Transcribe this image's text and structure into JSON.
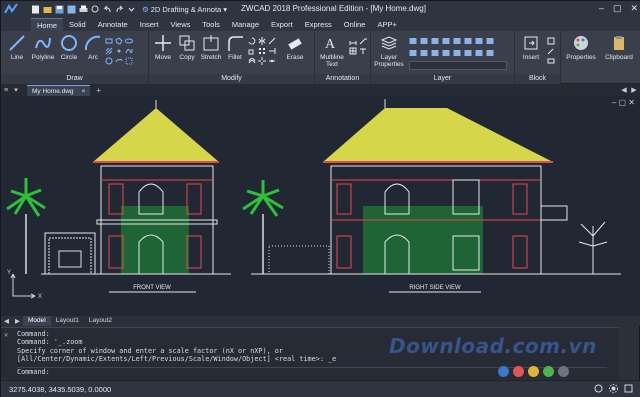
{
  "titlebar": {
    "workspace": "2D Drafting & Annota",
    "title": "ZWCAD 2018 Professional Edition - [My Home.dwg]",
    "controls": [
      "–",
      "▢",
      "✕"
    ]
  },
  "tabs": [
    "Home",
    "Solid",
    "Annotate",
    "Insert",
    "Views",
    "Tools",
    "Manage",
    "Export",
    "Express",
    "Online",
    "APP+"
  ],
  "ribbon": {
    "draw": {
      "title": "Draw",
      "tools": [
        "Line",
        "Polyline",
        "Circle",
        "Arc"
      ]
    },
    "modify": {
      "title": "Modify",
      "tools": [
        "Move",
        "Copy",
        "Stretch",
        "Fillet",
        "Erase"
      ]
    },
    "annotation": {
      "title": "Annotation",
      "tools": [
        "Multiline Text"
      ]
    },
    "layer": {
      "title": "Layer",
      "tools": [
        "Layer Properties"
      ]
    },
    "block": {
      "title": "Block",
      "tools": [
        "Insert"
      ]
    },
    "props": {
      "tools": [
        "Properties",
        "Clipboard"
      ]
    }
  },
  "doc_tab": {
    "name": "My Home.dwg",
    "close": "×",
    "add": "+"
  },
  "drawing": {
    "front_label": "FRONT VIEW",
    "side_label": "RIGHT SIDE VIEW",
    "axis_y": "Y",
    "axis_x": "X"
  },
  "layout_tabs": [
    "Model",
    "Layout1",
    "Layout2"
  ],
  "command_history": [
    "Command:",
    "Command: '_.zoom",
    "Specify corner of window and enter a scale factor (nX or nXP), or",
    "[All/Center/Dynamic/Extents/Left/Previous/Scale/Window/Object] <real time>: _e"
  ],
  "command_prompt": "Command:",
  "watermark": "Download.com.vn",
  "status": {
    "coordinates": "3275.4038, 3435.5039, 0.0000"
  },
  "colors": {
    "roof": "#d6d64a",
    "wall": "#e8e8e8",
    "trim": "#e24b4b",
    "tree": "#2fbf3a",
    "hedge": "#1d7a35",
    "dots": [
      "#3d79c9",
      "#e05555",
      "#e0b23a",
      "#4fb34f",
      "#6a7380"
    ]
  }
}
